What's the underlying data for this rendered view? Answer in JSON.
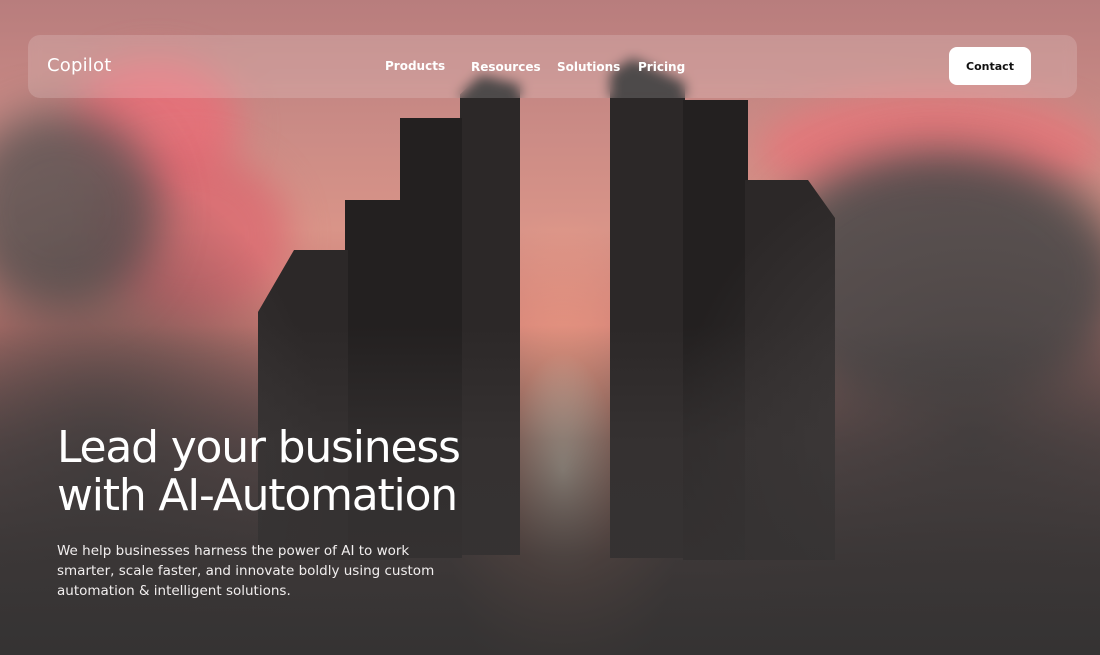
{
  "brand": {
    "name": "Copilot"
  },
  "nav": {
    "items": [
      {
        "label": "Products"
      },
      {
        "label": "Resources"
      },
      {
        "label": "Solutions"
      },
      {
        "label": "Pricing"
      }
    ],
    "contact_label": "Contact"
  },
  "hero": {
    "title_lines": [
      "Lead your business",
      "with AI-Automation"
    ],
    "description_lines": [
      "We help businesses harness the power of AI to work",
      "smarter, scale faster, and innovate boldly using custom",
      "automation & intelligent solutions."
    ]
  },
  "colors": {
    "sky_top": "#b87d7d",
    "sky_glow": "#ffeed7",
    "cloud_pink": "#e8707a",
    "tower": "#2c2828",
    "fog": "#3a3535",
    "button_bg": "#ffffff",
    "button_text": "#111111"
  }
}
